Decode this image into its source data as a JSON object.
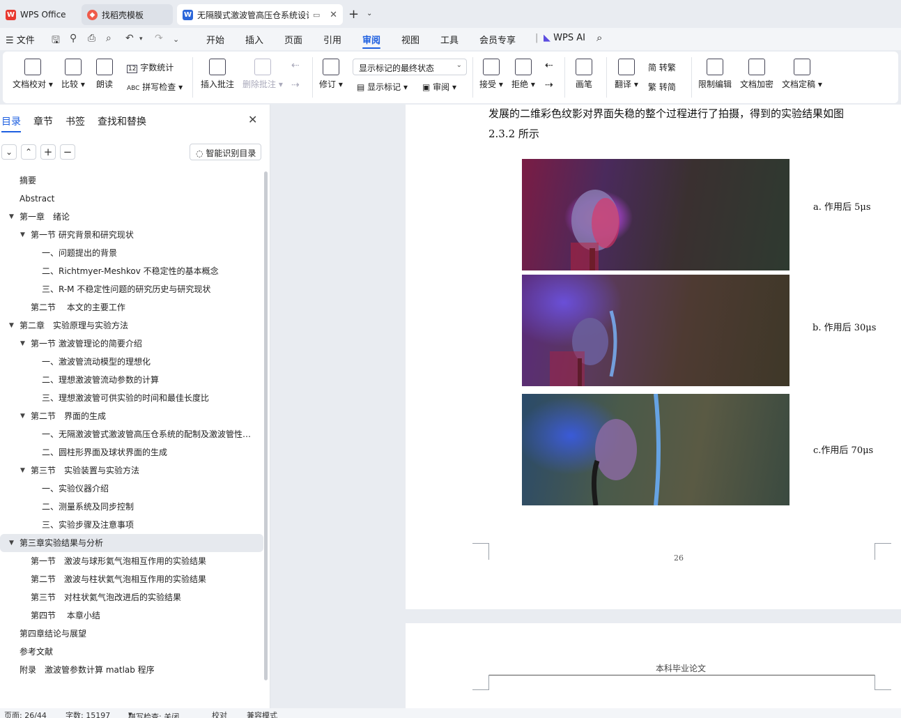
{
  "tabs": [
    {
      "label": "WPS Office",
      "icon": "wps-logo-icon"
    },
    {
      "label": "找稻壳模板",
      "icon": "docer-icon"
    },
    {
      "label": "无隔膜式激波管高压仓系统设计",
      "icon": "word-doc-icon"
    }
  ],
  "menubar": {
    "file": "文件",
    "items": [
      "开始",
      "插入",
      "页面",
      "引用",
      "审阅",
      "视图",
      "工具",
      "会员专享"
    ],
    "active": "审阅",
    "ai_label": "WPS AI"
  },
  "ribbon": {
    "proofread": "文档校对",
    "compare": "比较",
    "read_aloud": "朗读",
    "word_count": "字数统计",
    "spell_check": "拼写检查",
    "insert_comment": "插入批注",
    "delete_comment": "删除批注",
    "track_changes": "修订",
    "markup_select": "显示标记的最终状态",
    "show_markup": "显示标记",
    "review": "审阅",
    "accept": "接受",
    "reject": "拒绝",
    "pen": "画笔",
    "translate": "翻译",
    "to_traditional": "转繁",
    "to_simplified": "转简",
    "restrict_edit": "限制编辑",
    "encrypt": "文档加密",
    "finalize": "文档定稿"
  },
  "panel": {
    "tabs": [
      "目录",
      "章节",
      "书签",
      "查找和替换"
    ],
    "ai_toc": "智能识别目录",
    "toc": [
      {
        "label": "摘要",
        "level": 1,
        "toggle": false
      },
      {
        "label": "Abstract",
        "level": 1,
        "toggle": false
      },
      {
        "label": "第一章　绪论",
        "level": 1,
        "toggle": true
      },
      {
        "label": "第一节  研究背景和研究现状",
        "level": 2,
        "toggle": true
      },
      {
        "label": "一、问题提出的背景",
        "level": 3,
        "toggle": false
      },
      {
        "label": "二、Richtmyer-Meshkov 不稳定性的基本概念",
        "level": 3,
        "toggle": false
      },
      {
        "label": "三、R-M 不稳定性问题的研究历史与研究现状",
        "level": 3,
        "toggle": false
      },
      {
        "label": "第二节　 本文的主要工作",
        "level": 2,
        "toggle": false
      },
      {
        "label": "第二章　实验原理与实验方法",
        "level": 1,
        "toggle": true
      },
      {
        "label": "第一节  激波管理论的简要介绍",
        "level": 2,
        "toggle": true
      },
      {
        "label": "一、激波管流动模型的理想化",
        "level": 3,
        "toggle": false
      },
      {
        "label": "二、理想激波管流动参数的计算",
        "level": 3,
        "toggle": false
      },
      {
        "label": "三、理想激波管可供实验的时间和最佳长度比",
        "level": 3,
        "toggle": false
      },
      {
        "label": "第二节　界面的生成",
        "level": 2,
        "toggle": true
      },
      {
        "label": "一、无隔激波管式激波管高压仓系统的配制及激波管性能分析",
        "level": 3,
        "toggle": false
      },
      {
        "label": "二、圆柱形界面及球状界面的生成",
        "level": 3,
        "toggle": false
      },
      {
        "label": "第三节　实验装置与实验方法",
        "level": 2,
        "toggle": true
      },
      {
        "label": "一、实验仪器介绍",
        "level": 3,
        "toggle": false
      },
      {
        "label": "二、测量系统及同步控制",
        "level": 3,
        "toggle": false
      },
      {
        "label": "三、实验步骤及注意事项",
        "level": 3,
        "toggle": false
      },
      {
        "label": "第三章实验结果与分析",
        "level": 1,
        "toggle": true,
        "highlight": true
      },
      {
        "label": "第一节　激波与球形氦气泡相互作用的实验结果",
        "level": 2,
        "toggle": false
      },
      {
        "label": "第二节　激波与柱状氦气泡相互作用的实验结果",
        "level": 2,
        "toggle": false
      },
      {
        "label": "第三节　对柱状氦气泡改进后的实验结果",
        "level": 2,
        "toggle": false
      },
      {
        "label": "第四节　 本章小结",
        "level": 2,
        "toggle": false
      },
      {
        "label": "第四章结论与展望",
        "level": 1,
        "toggle": false
      },
      {
        "label": "参考文献",
        "level": 1,
        "toggle": false
      },
      {
        "label": "附录　激波管参数计算 matlab 程序",
        "level": 1,
        "toggle": false
      }
    ]
  },
  "document": {
    "line1": "发展的二维彩色纹影对界面失稳的整个过程进行了拍摄，得到的实验结果如图",
    "line2": "2.3.2 所示",
    "captions": [
      "a. 作用后 5μs",
      "b. 作用后 30μs",
      "c.作用后 70μs"
    ],
    "page_number": "26",
    "next_header": "本科毕业论文"
  },
  "status": {
    "page": "页面: 26/44",
    "words": "字数: 15197",
    "spell": "拼写检查: 关闭",
    "proof": "校对",
    "compat": "兼容模式"
  },
  "colors": {
    "accent": "#1d5fe0",
    "wps_red": "#e8382f",
    "doc_blue": "#2b66d9"
  }
}
